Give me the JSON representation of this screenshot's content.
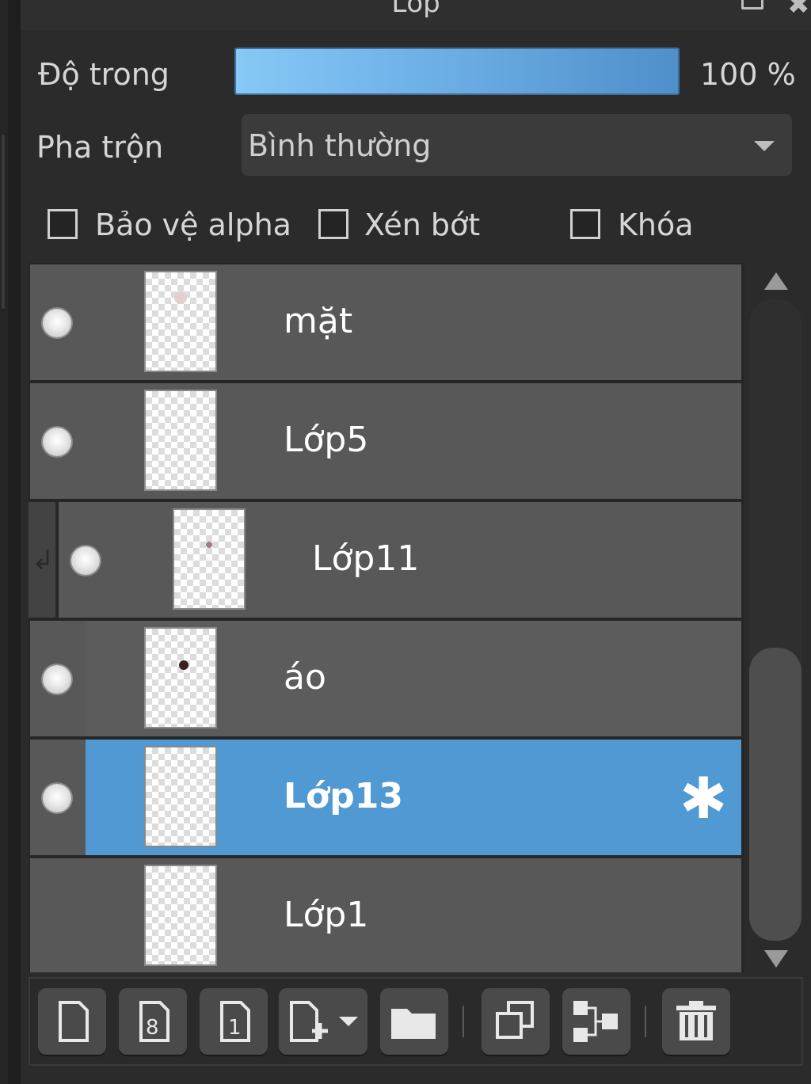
{
  "panel": {
    "title": "Lớp",
    "float_icon": "float-icon",
    "close_icon": "close-icon"
  },
  "opacity": {
    "label": "Độ trong",
    "value": 1.0,
    "value_text": "100 %"
  },
  "blend": {
    "label": "Pha trộn",
    "value": "Bình thường"
  },
  "checks": [
    {
      "label": "Bảo vệ alpha",
      "checked": false
    },
    {
      "label": "Xén bớt",
      "checked": false
    },
    {
      "label": "Khóa",
      "checked": false
    }
  ],
  "layers": [
    {
      "name": "mặt",
      "visible": true,
      "clipped": false,
      "selected": false
    },
    {
      "name": "Lớp5",
      "visible": true,
      "clipped": false,
      "selected": false
    },
    {
      "name": "Lớp11",
      "visible": true,
      "clipped": true,
      "selected": false
    },
    {
      "name": "áo",
      "visible": true,
      "clipped": false,
      "selected": false
    },
    {
      "name": "Lớp13",
      "visible": true,
      "clipped": false,
      "selected": true,
      "settings_icon": "gear-icon"
    },
    {
      "name": "Lớp1",
      "visible": false,
      "clipped": false,
      "selected": false
    }
  ],
  "toolbar": [
    {
      "icon": "new-layer-icon"
    },
    {
      "icon": "new-8bit-layer-icon"
    },
    {
      "icon": "new-1bit-layer-icon"
    },
    {
      "icon": "add-layer-dropdown-icon"
    },
    {
      "icon": "folder-icon"
    },
    {
      "icon": "duplicate-layer-icon"
    },
    {
      "icon": "merge-down-icon"
    },
    {
      "icon": "delete-icon"
    }
  ],
  "colors": {
    "selected_row": "#5099d2",
    "row": "#585858",
    "opacity_bar_start": "#86c8f6",
    "opacity_bar_end": "#4f8fca"
  }
}
